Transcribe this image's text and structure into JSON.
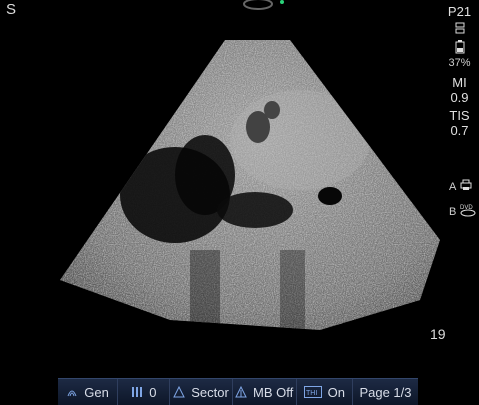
{
  "screen": {
    "corner_marker": "S",
    "depth_value": "19"
  },
  "side_panel": {
    "preset": "P21",
    "battery_icon": "battery-icon",
    "battery_percent": "37%",
    "mi_label": "MI",
    "mi_value": "0.9",
    "tis_label": "TIS",
    "tis_value": "0.7",
    "print_label": "A",
    "print_icon": "printer-icon",
    "dvd_label": "B",
    "dvd_icon": "dvd-icon"
  },
  "toolbar": {
    "gen": {
      "icon": "probe-icon",
      "label": "Gen"
    },
    "gain": {
      "icon": "bars-icon",
      "label": "0"
    },
    "sector": {
      "icon": "sector-icon",
      "label": "Sector"
    },
    "mb": {
      "icon": "mb-icon",
      "label": "MB Off"
    },
    "thi": {
      "icon": "thi-icon",
      "label": "On"
    },
    "page": {
      "label": "Page 1/3"
    }
  },
  "colors": {
    "toolbar_bg": "#13203a",
    "accent": "#7fa6e6"
  }
}
